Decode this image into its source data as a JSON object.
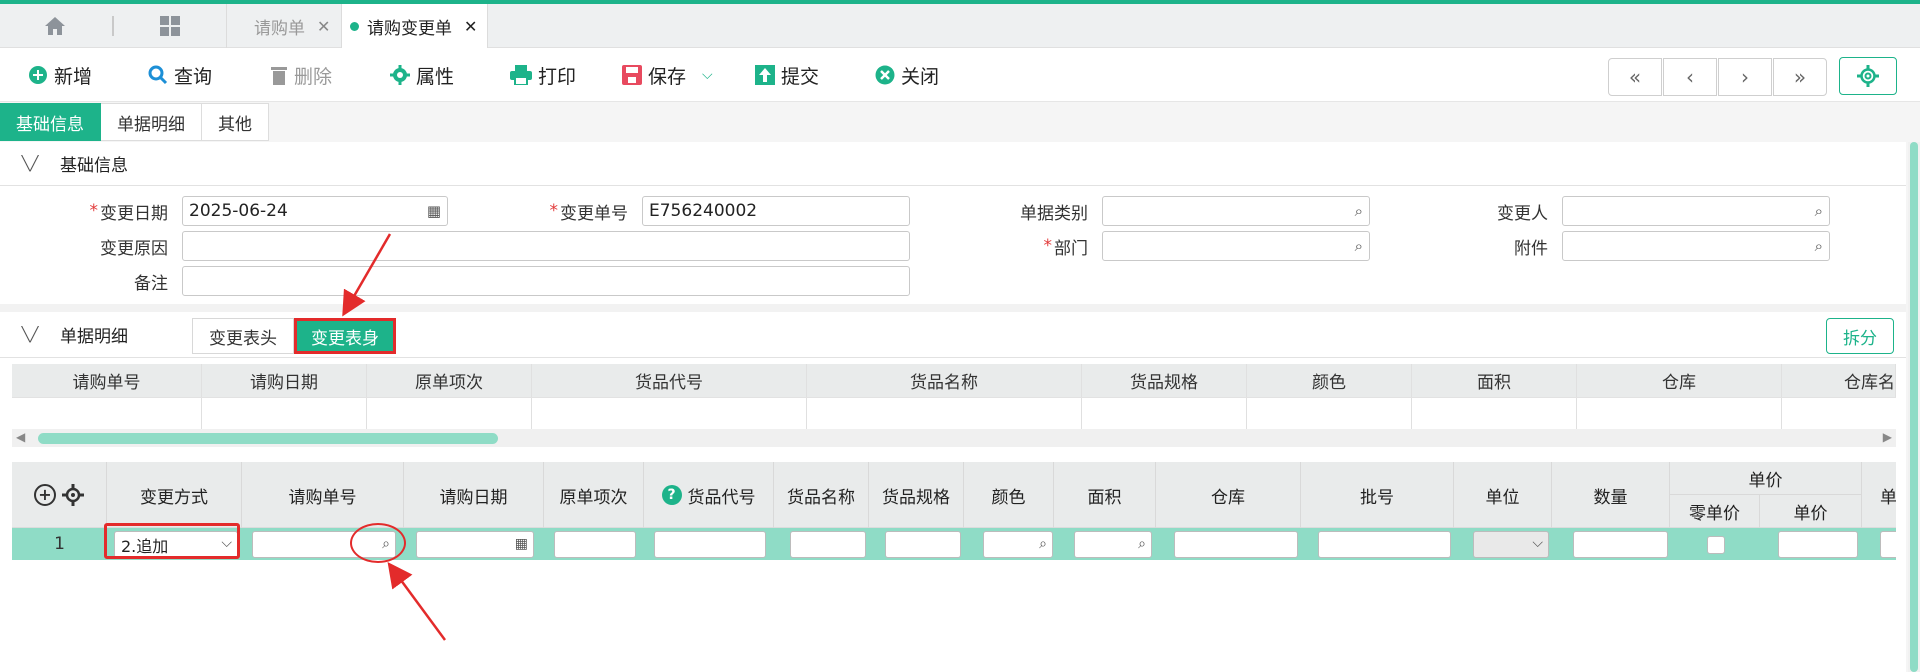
{
  "tabs": {
    "home_icon": "home-icon",
    "grid_icon": "apps-grid-icon",
    "items": [
      {
        "label": "请购单",
        "close": "✕"
      },
      {
        "label": "请购变更单",
        "close": "✕"
      }
    ]
  },
  "toolbar": {
    "add": "新增",
    "query": "查询",
    "delete": "删除",
    "properties": "属性",
    "print": "打印",
    "save": "保存",
    "submit": "提交",
    "close": "关闭"
  },
  "section_tabs": [
    "基础信息",
    "单据明细",
    "其他"
  ],
  "basic": {
    "title": "基础信息",
    "change_date_label": "变更日期",
    "change_date_value": "2025-06-24",
    "change_no_label": "变更单号",
    "change_no_value": "E756240002",
    "doc_type_label": "单据类别",
    "doc_type_value": "",
    "changer_label": "变更人",
    "changer_value": "",
    "reason_label": "变更原因",
    "reason_value": "",
    "dept_label": "部门",
    "dept_value": "",
    "attachment_label": "附件",
    "attachment_value": "",
    "remark_label": "备注",
    "remark_value": ""
  },
  "detail": {
    "title": "单据明细",
    "subtab_head": "变更表头",
    "subtab_body": "变更表身",
    "split": "拆分",
    "upper_columns": [
      "请购单号",
      "请购日期",
      "原单项次",
      "货品代号",
      "货品名称",
      "货品规格",
      "颜色",
      "面积",
      "仓库",
      "仓库名"
    ],
    "lower_columns": {
      "change_mode": "变更方式",
      "request_no": "请购单号",
      "request_date": "请购日期",
      "orig_item": "原单项次",
      "item_code": "货品代号",
      "item_name": "货品名称",
      "item_spec": "货品规格",
      "color": "颜色",
      "area": "面积",
      "warehouse": "仓库",
      "batch": "批号",
      "unit": "单位",
      "qty": "数量",
      "price_group": "单价",
      "zero_price": "零单价",
      "price": "单价",
      "next_partial": "单"
    },
    "row": {
      "index": "1",
      "change_mode": "2.追加"
    }
  },
  "colors": {
    "accent": "#1db38a",
    "highlight_row": "#8fdcc6",
    "annotation_red": "#e32b2b"
  }
}
